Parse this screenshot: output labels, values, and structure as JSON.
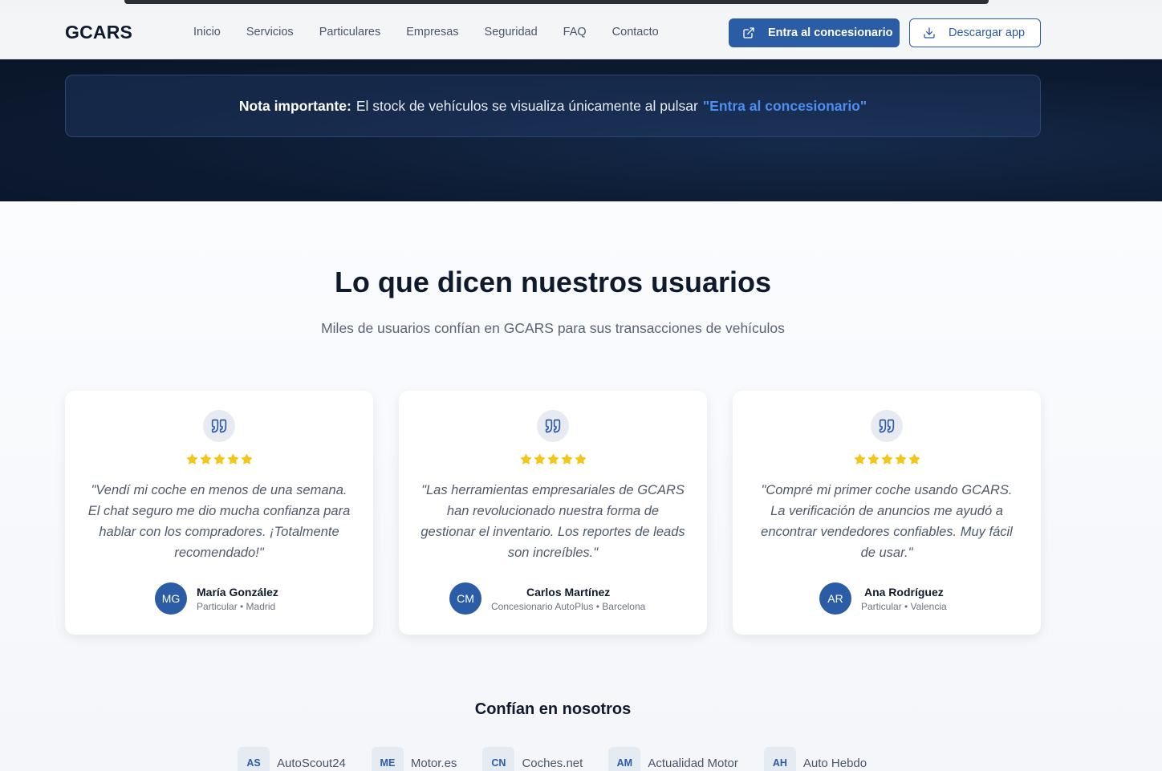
{
  "nav": {
    "logo": "GCARS",
    "menu": [
      "Inicio",
      "Servicios",
      "Particulares",
      "Empresas",
      "Seguridad",
      "FAQ",
      "Contacto"
    ],
    "primary_button": "Entra al concesionario",
    "secondary_button": "Descargar app"
  },
  "notice": {
    "label": "Nota importante:",
    "text": "El stock de vehículos se visualiza únicamente al pulsar",
    "link": "\"Entra al concesionario\""
  },
  "testimonials": {
    "title": "Lo que dicen nuestros usuarios",
    "subtitle": "Miles de usuarios confían en GCARS para sus transacciones de vehículos",
    "rating": 5,
    "items": [
      {
        "quote": "\"Vendí mi coche en menos de una semana. El chat seguro me dio mucha confianza para hablar con los compradores. ¡Totalmente recomendado!\"",
        "initials": "MG",
        "name": "María González",
        "role": "Particular • Madrid"
      },
      {
        "quote": "\"Las herramientas empresariales de GCARS han revolucionado nuestra forma de gestionar el inventario. Los reportes de leads son increíbles.\"",
        "initials": "CM",
        "name": "Carlos Martínez",
        "role": "Concesionario AutoPlus • Barcelona"
      },
      {
        "quote": "\"Compré mi primer coche usando GCARS. La verificación de anuncios me ayudó a encontrar vendedores confiables. Muy fácil de usar.\"",
        "initials": "AR",
        "name": "Ana Rodríguez",
        "role": "Particular • Valencia"
      }
    ]
  },
  "trust": {
    "title": "Confían en nosotros",
    "partners": [
      {
        "abbr": "AS",
        "name": "AutoScout24"
      },
      {
        "abbr": "ME",
        "name": "Motor.es"
      },
      {
        "abbr": "CN",
        "name": "Coches.net"
      },
      {
        "abbr": "AM",
        "name": "Actualidad Motor"
      },
      {
        "abbr": "AH",
        "name": "Auto Hebdo"
      }
    ]
  },
  "colors": {
    "brand": "#2b5ca6",
    "star": "#f5c518",
    "hero_bg": "#0c1a30",
    "link": "#4c8ff0"
  },
  "icons": [
    "external-link-icon",
    "download-icon",
    "quote-icon",
    "star-icon"
  ]
}
